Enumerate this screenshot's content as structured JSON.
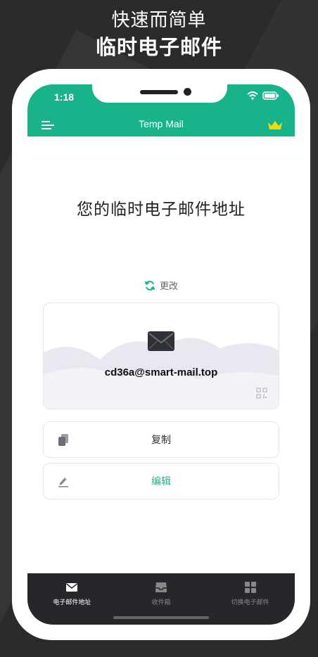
{
  "promo": {
    "line1": "快速而简单",
    "line2": "临时电子邮件"
  },
  "status_bar": {
    "time": "1:18"
  },
  "header": {
    "title": "Temp Mail"
  },
  "main": {
    "heading": "您的临时电子邮件地址",
    "change_label": "更改",
    "email": "cd36a@smart-mail.top",
    "copy_label": "复制",
    "edit_label": "编辑"
  },
  "tabbar": {
    "items": [
      {
        "label": "电子邮件地址",
        "icon": "mail-icon",
        "active": true
      },
      {
        "label": "收件箱",
        "icon": "inbox-icon",
        "active": false
      },
      {
        "label": "切换电子邮件",
        "icon": "grid-icon",
        "active": false
      }
    ]
  },
  "colors": {
    "accent": "#19b38b",
    "tabbar": "#26272b",
    "background": "#2b2b2d",
    "crown": "#f5d90a"
  }
}
